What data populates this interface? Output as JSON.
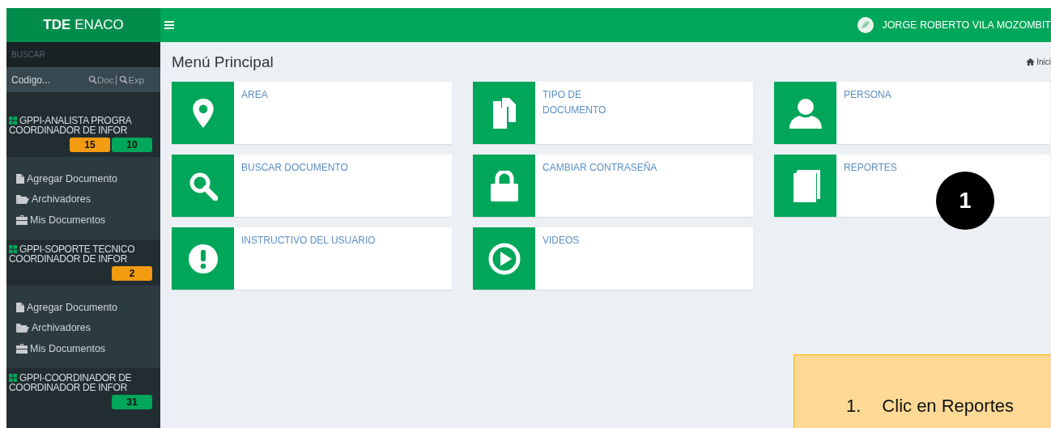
{
  "brand": {
    "bold": "TDE",
    "rest": "ENACO"
  },
  "user": {
    "name": "JORGE ROBERTO VILA MOZOMBIT"
  },
  "sidebar": {
    "search_label": "BUSCAR",
    "search": {
      "placeholder": "Codigo...",
      "doc": "Doc",
      "exp": "Exp"
    },
    "groups": [
      {
        "title": "GPPI-ANALISTA PROGRA",
        "subtitle": "COORDINADOR DE INFOR",
        "badges": [
          {
            "text": "15",
            "color": "#f39c12"
          },
          {
            "text": "10",
            "color": "#00a65a"
          }
        ],
        "items": [
          {
            "kind": "file",
            "label": "Agregar Documento"
          },
          {
            "kind": "folder",
            "label": "Archivadores"
          },
          {
            "kind": "briefcase",
            "label": "Mis Documentos"
          }
        ]
      },
      {
        "title": "GPPI-SOPORTE TECNICO",
        "subtitle": "COORDINADOR DE INFOR",
        "badges": [
          {
            "text": "2",
            "color": "#f39c12"
          }
        ],
        "items": [
          {
            "kind": "file",
            "label": "Agregar Documento"
          },
          {
            "kind": "folder",
            "label": "Archivadores"
          },
          {
            "kind": "briefcase",
            "label": "Mis Documentos"
          }
        ]
      },
      {
        "title": "GPPI-COORDINADOR DE",
        "subtitle": "COORDINADOR DE INFOR",
        "badges": [
          {
            "text": "31",
            "color": "#00a65a"
          }
        ]
      }
    ]
  },
  "page": {
    "title": "Menú Principal",
    "breadcrumb": "Inici"
  },
  "tiles": [
    {
      "kind": "pin",
      "label": "AREA"
    },
    {
      "kind": "copy",
      "label": "TIPO DE\nDOCUMENTO"
    },
    {
      "kind": "user",
      "label": "PERSONA"
    },
    {
      "kind": "search",
      "label": "BUSCAR DOCUMENTO"
    },
    {
      "kind": "lock",
      "label": "CAMBIAR CONTRASEÑA"
    },
    {
      "kind": "book",
      "label": "REPORTES"
    },
    {
      "kind": "alert",
      "label": "INSTRUCTIVO DEL USUARIO"
    },
    {
      "kind": "play",
      "label": "VIDEOS"
    }
  ],
  "annotation": {
    "marker": "1",
    "number": "1.",
    "note": "Clic en Reportes"
  }
}
